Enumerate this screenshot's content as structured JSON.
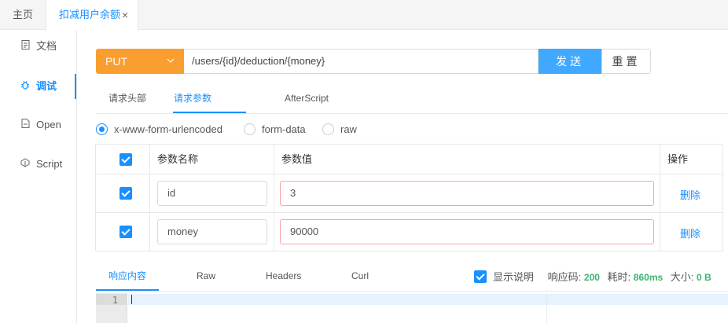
{
  "tabs": {
    "home": "主页",
    "active": "扣减用户余额",
    "close": "×"
  },
  "sidebar": {
    "items": [
      {
        "label": "文档",
        "icon": "document-icon"
      },
      {
        "label": "调试",
        "icon": "bug-icon"
      },
      {
        "label": "Open",
        "icon": "file-icon"
      },
      {
        "label": "Script",
        "icon": "code-icon"
      }
    ]
  },
  "request": {
    "method": "PUT",
    "url": "/users/{id}/deduction/{money}",
    "send": "发送",
    "reset": "重置"
  },
  "subtabs": [
    "请求头部",
    "请求参数",
    "AfterScript"
  ],
  "radios": {
    "options": [
      "x-www-form-urlencoded",
      "form-data",
      "raw"
    ],
    "selected": "x-www-form-urlencoded"
  },
  "params": {
    "headers": {
      "name": "参数名称",
      "value": "参数值",
      "action": "操作"
    },
    "rows": [
      {
        "name": "id",
        "value": "3",
        "action": "删除"
      },
      {
        "name": "money",
        "value": "90000",
        "action": "删除"
      }
    ]
  },
  "response": {
    "tabs": [
      "响应内容",
      "Raw",
      "Headers",
      "Curl"
    ],
    "show_desc_label": "显示说明",
    "status_label": "响应码:",
    "status": "200",
    "time_label": "耗时:",
    "time": "860ms",
    "size_label": "大小:",
    "size": "0 B"
  },
  "editor": {
    "line_number": "1"
  },
  "colors": {
    "accent": "#1890ff",
    "method": "#fa9e2f",
    "success": "#3cb371"
  }
}
